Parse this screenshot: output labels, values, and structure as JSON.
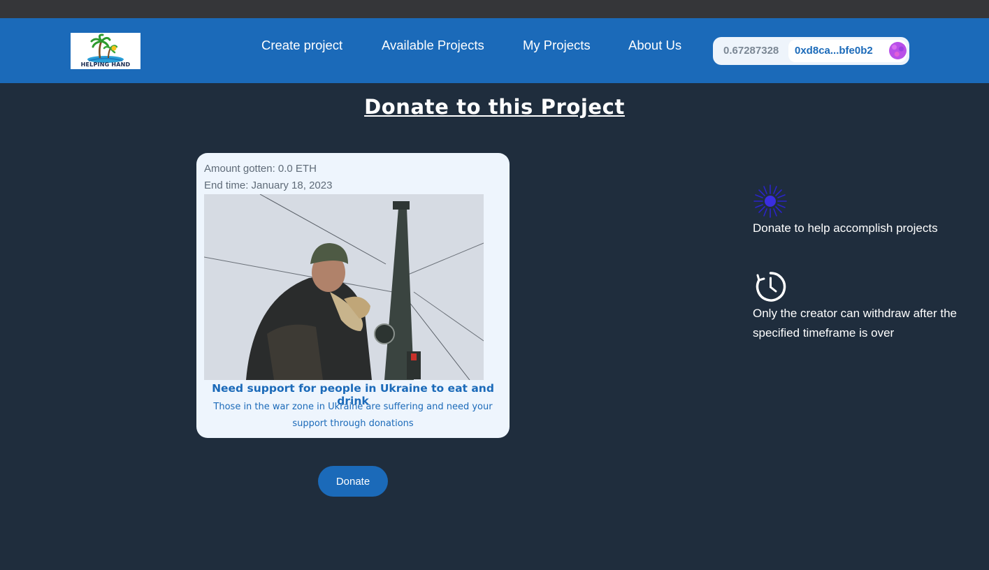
{
  "navbar": {
    "logo_text": "HELPING HAND",
    "links": {
      "create": "Create project",
      "available": "Available Projects",
      "my": "My Projects",
      "about": "About Us"
    },
    "wallet": {
      "balance": "0.67287328",
      "address": "0xd8ca...bfe0b2"
    }
  },
  "page": {
    "title": "Donate to this Project"
  },
  "project": {
    "amount": "Amount gotten: 0.0 ETH",
    "end_time": "End time: January 18, 2023",
    "title": "Need support for people in Ukraine to eat and drink",
    "description": "Those in the war zone in Ukraine are suffering and need your support through donations"
  },
  "actions": {
    "donate_label": "Donate"
  },
  "features": [
    {
      "icon": "sparkle-icon",
      "text": "Donate to help accomplish projects"
    },
    {
      "icon": "clock-icon",
      "text": "Only the creator can withdraw after the specified timeframe is over"
    }
  ],
  "colors": {
    "background": "#1f2d3d",
    "navbar": "#1b6ab9",
    "card": "#eef5fd",
    "accent": "#1b6ab9"
  }
}
